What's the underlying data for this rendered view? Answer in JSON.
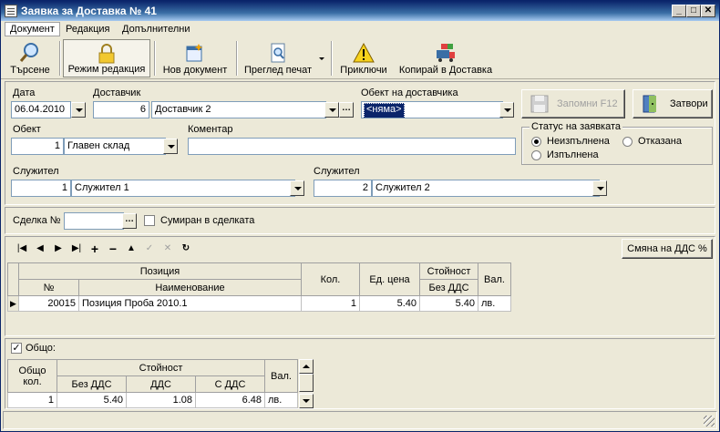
{
  "window": {
    "title": "Заявка за Доставка № 41"
  },
  "menu": [
    "Документ",
    "Редакция",
    "Допълнителни"
  ],
  "toolbar": {
    "search": "Търсене",
    "edit_mode": "Режим редакция",
    "new_doc": "Нов документ",
    "print_preview": "Преглед печат",
    "finish": "Приключи",
    "copy_delivery": "Копирай в Доставка"
  },
  "form": {
    "date_label": "Дата",
    "date_value": "06.04.2010",
    "supplier_label": "Доставчик",
    "supplier_id": "6",
    "supplier_name": "Доставчик 2",
    "supplier_object_label": "Обект на доставчика",
    "supplier_object_value": "<няма>",
    "object_label": "Обект",
    "object_id": "1",
    "object_name": "Главен склад",
    "comment_label": "Коментар",
    "comment_value": "",
    "employee1_label": "Служител",
    "employee1_id": "1",
    "employee1_name": "Служител 1",
    "employee2_label": "Служител",
    "employee2_id": "2",
    "employee2_name": "Служител 2",
    "save_button": "Запомни  F12",
    "close_button": "Затвори",
    "status_title": "Статус на заявката",
    "status_options": [
      "Неизпълнена",
      "Отказана",
      "Изпълнена"
    ],
    "status_selected": "Неизпълнена"
  },
  "deal": {
    "label": "Сделка №",
    "value": "",
    "summed_label": "Сумиран в сделката",
    "summed_checked": false
  },
  "items": {
    "vat_button": "Смяна на ДДС %",
    "headers": {
      "position_group": "Позиция",
      "no": "№",
      "name": "Наименование",
      "qty": "Кол.",
      "unit_price": "Ед. цена",
      "value_group": "Стойност",
      "value_no_vat": "Без ДДС",
      "currency": "Вал."
    },
    "rows": [
      {
        "no": "20015",
        "name": "Позиция Проба 2010.1",
        "qty": "1",
        "unit_price": "5.40",
        "value_no_vat": "5.40",
        "currency": "лв."
      }
    ]
  },
  "totals": {
    "checkbox_label": "Общо:",
    "checked": true,
    "headers": {
      "total_qty": "Общо кол.",
      "value_group": "Стойност",
      "no_vat": "Без ДДС",
      "vat": "ДДС",
      "with_vat": "С ДДС",
      "currency": "Вал."
    },
    "row": {
      "total_qty": "1",
      "no_vat": "5.40",
      "vat": "1.08",
      "with_vat": "6.48",
      "currency": "лв."
    }
  }
}
